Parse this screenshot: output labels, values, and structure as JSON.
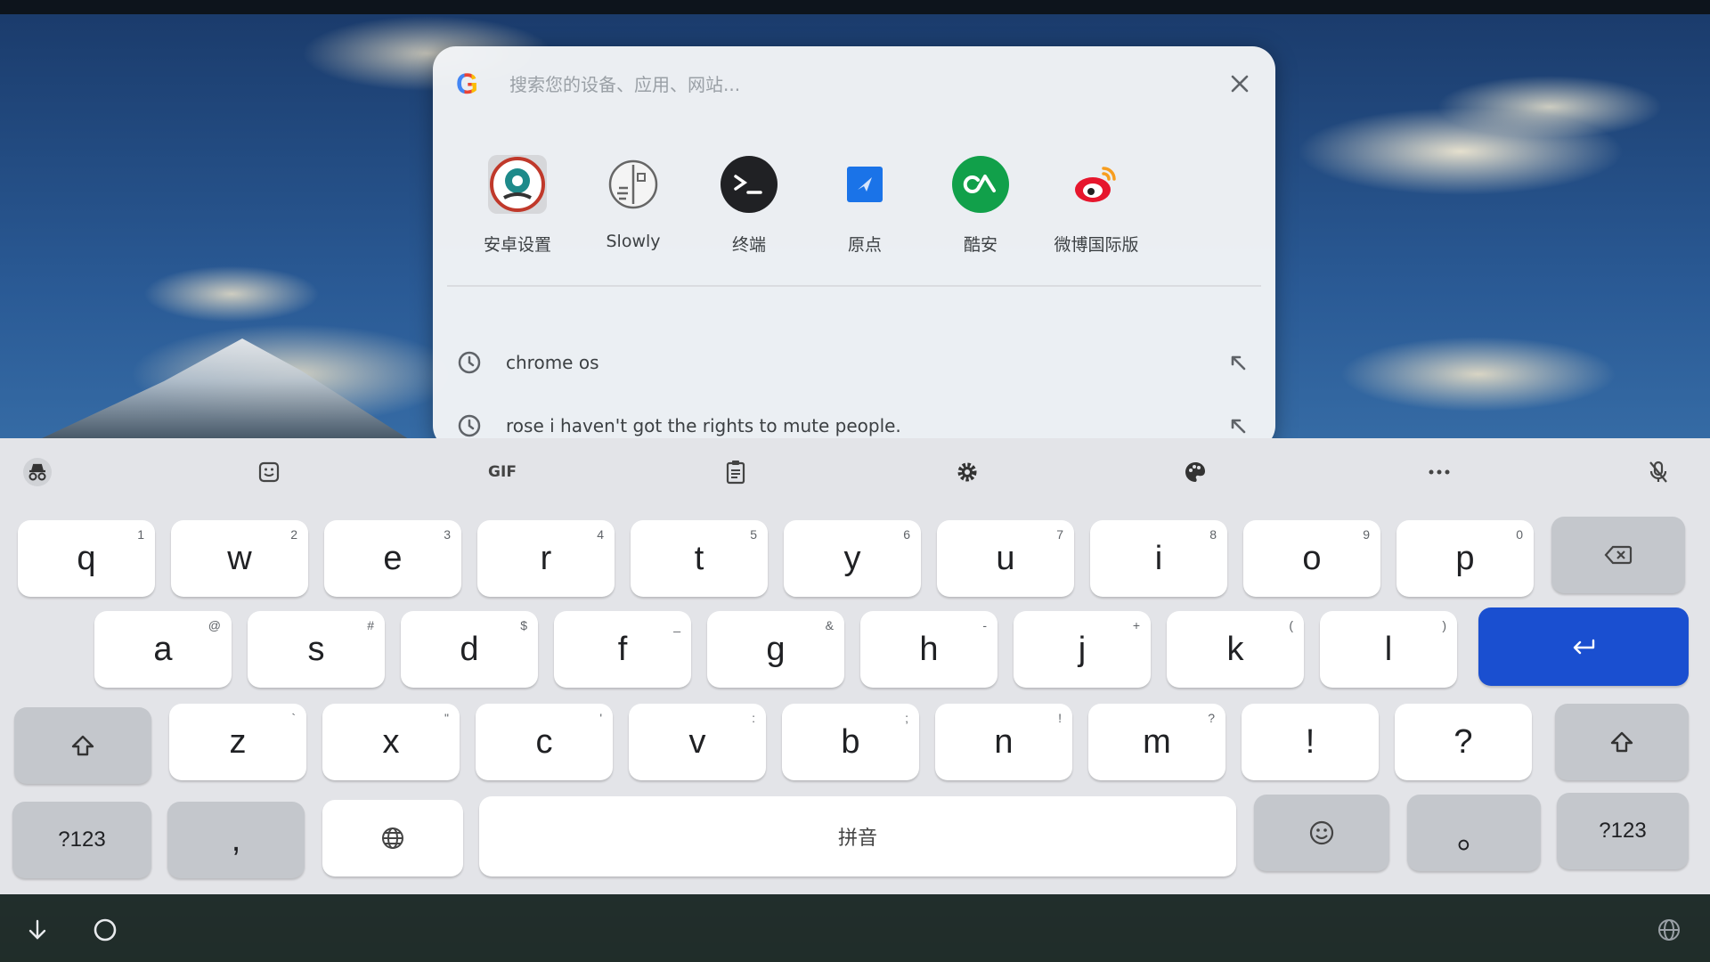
{
  "search": {
    "placeholder": "搜索您的设备、应用、网站...",
    "close_icon": "close-icon"
  },
  "apps": [
    {
      "label": "安卓设置",
      "icon": "android-settings-icon"
    },
    {
      "label": "Slowly",
      "icon": "slowly-icon"
    },
    {
      "label": "终端",
      "icon": "terminal-icon"
    },
    {
      "label": "原点",
      "icon": "yuandian-icon"
    },
    {
      "label": "酷安",
      "icon": "coolapk-icon"
    },
    {
      "label": "微博国际版",
      "icon": "weibo-icon"
    }
  ],
  "suggestions": [
    {
      "text": "chrome os",
      "icon": "history-icon"
    },
    {
      "text": "rose i haven't got the rights to mute people.",
      "icon": "history-icon"
    }
  ],
  "keyboard": {
    "toolbar": {
      "gif_label": "GIF"
    },
    "row1": [
      {
        "key": "q",
        "hint": "1"
      },
      {
        "key": "w",
        "hint": "2"
      },
      {
        "key": "e",
        "hint": "3"
      },
      {
        "key": "r",
        "hint": "4"
      },
      {
        "key": "t",
        "hint": "5"
      },
      {
        "key": "y",
        "hint": "6"
      },
      {
        "key": "u",
        "hint": "7"
      },
      {
        "key": "i",
        "hint": "8"
      },
      {
        "key": "o",
        "hint": "9"
      },
      {
        "key": "p",
        "hint": "0"
      }
    ],
    "row2": [
      {
        "key": "a",
        "hint": "@"
      },
      {
        "key": "s",
        "hint": "#"
      },
      {
        "key": "d",
        "hint": "$"
      },
      {
        "key": "f",
        "hint": "_"
      },
      {
        "key": "g",
        "hint": "&"
      },
      {
        "key": "h",
        "hint": "-"
      },
      {
        "key": "j",
        "hint": "+"
      },
      {
        "key": "k",
        "hint": "("
      },
      {
        "key": "l",
        "hint": ")"
      }
    ],
    "row3": [
      {
        "key": "z",
        "hint": "`"
      },
      {
        "key": "x",
        "hint": "\""
      },
      {
        "key": "c",
        "hint": "'"
      },
      {
        "key": "v",
        "hint": ":"
      },
      {
        "key": "b",
        "hint": ";"
      },
      {
        "key": "n",
        "hint": "!"
      },
      {
        "key": "m",
        "hint": "?"
      },
      {
        "key": "!",
        "hint": ""
      },
      {
        "key": "?",
        "hint": ""
      }
    ],
    "symbols_label": "?123",
    "comma_label": ",",
    "space_label": "拼音",
    "period_label": "。",
    "symbols_label_right": "?123"
  },
  "colors": {
    "enter_key": "#1a4fd0",
    "panel_bg": "#f2f4f6",
    "keyboard_bg": "#e3e4e8"
  }
}
